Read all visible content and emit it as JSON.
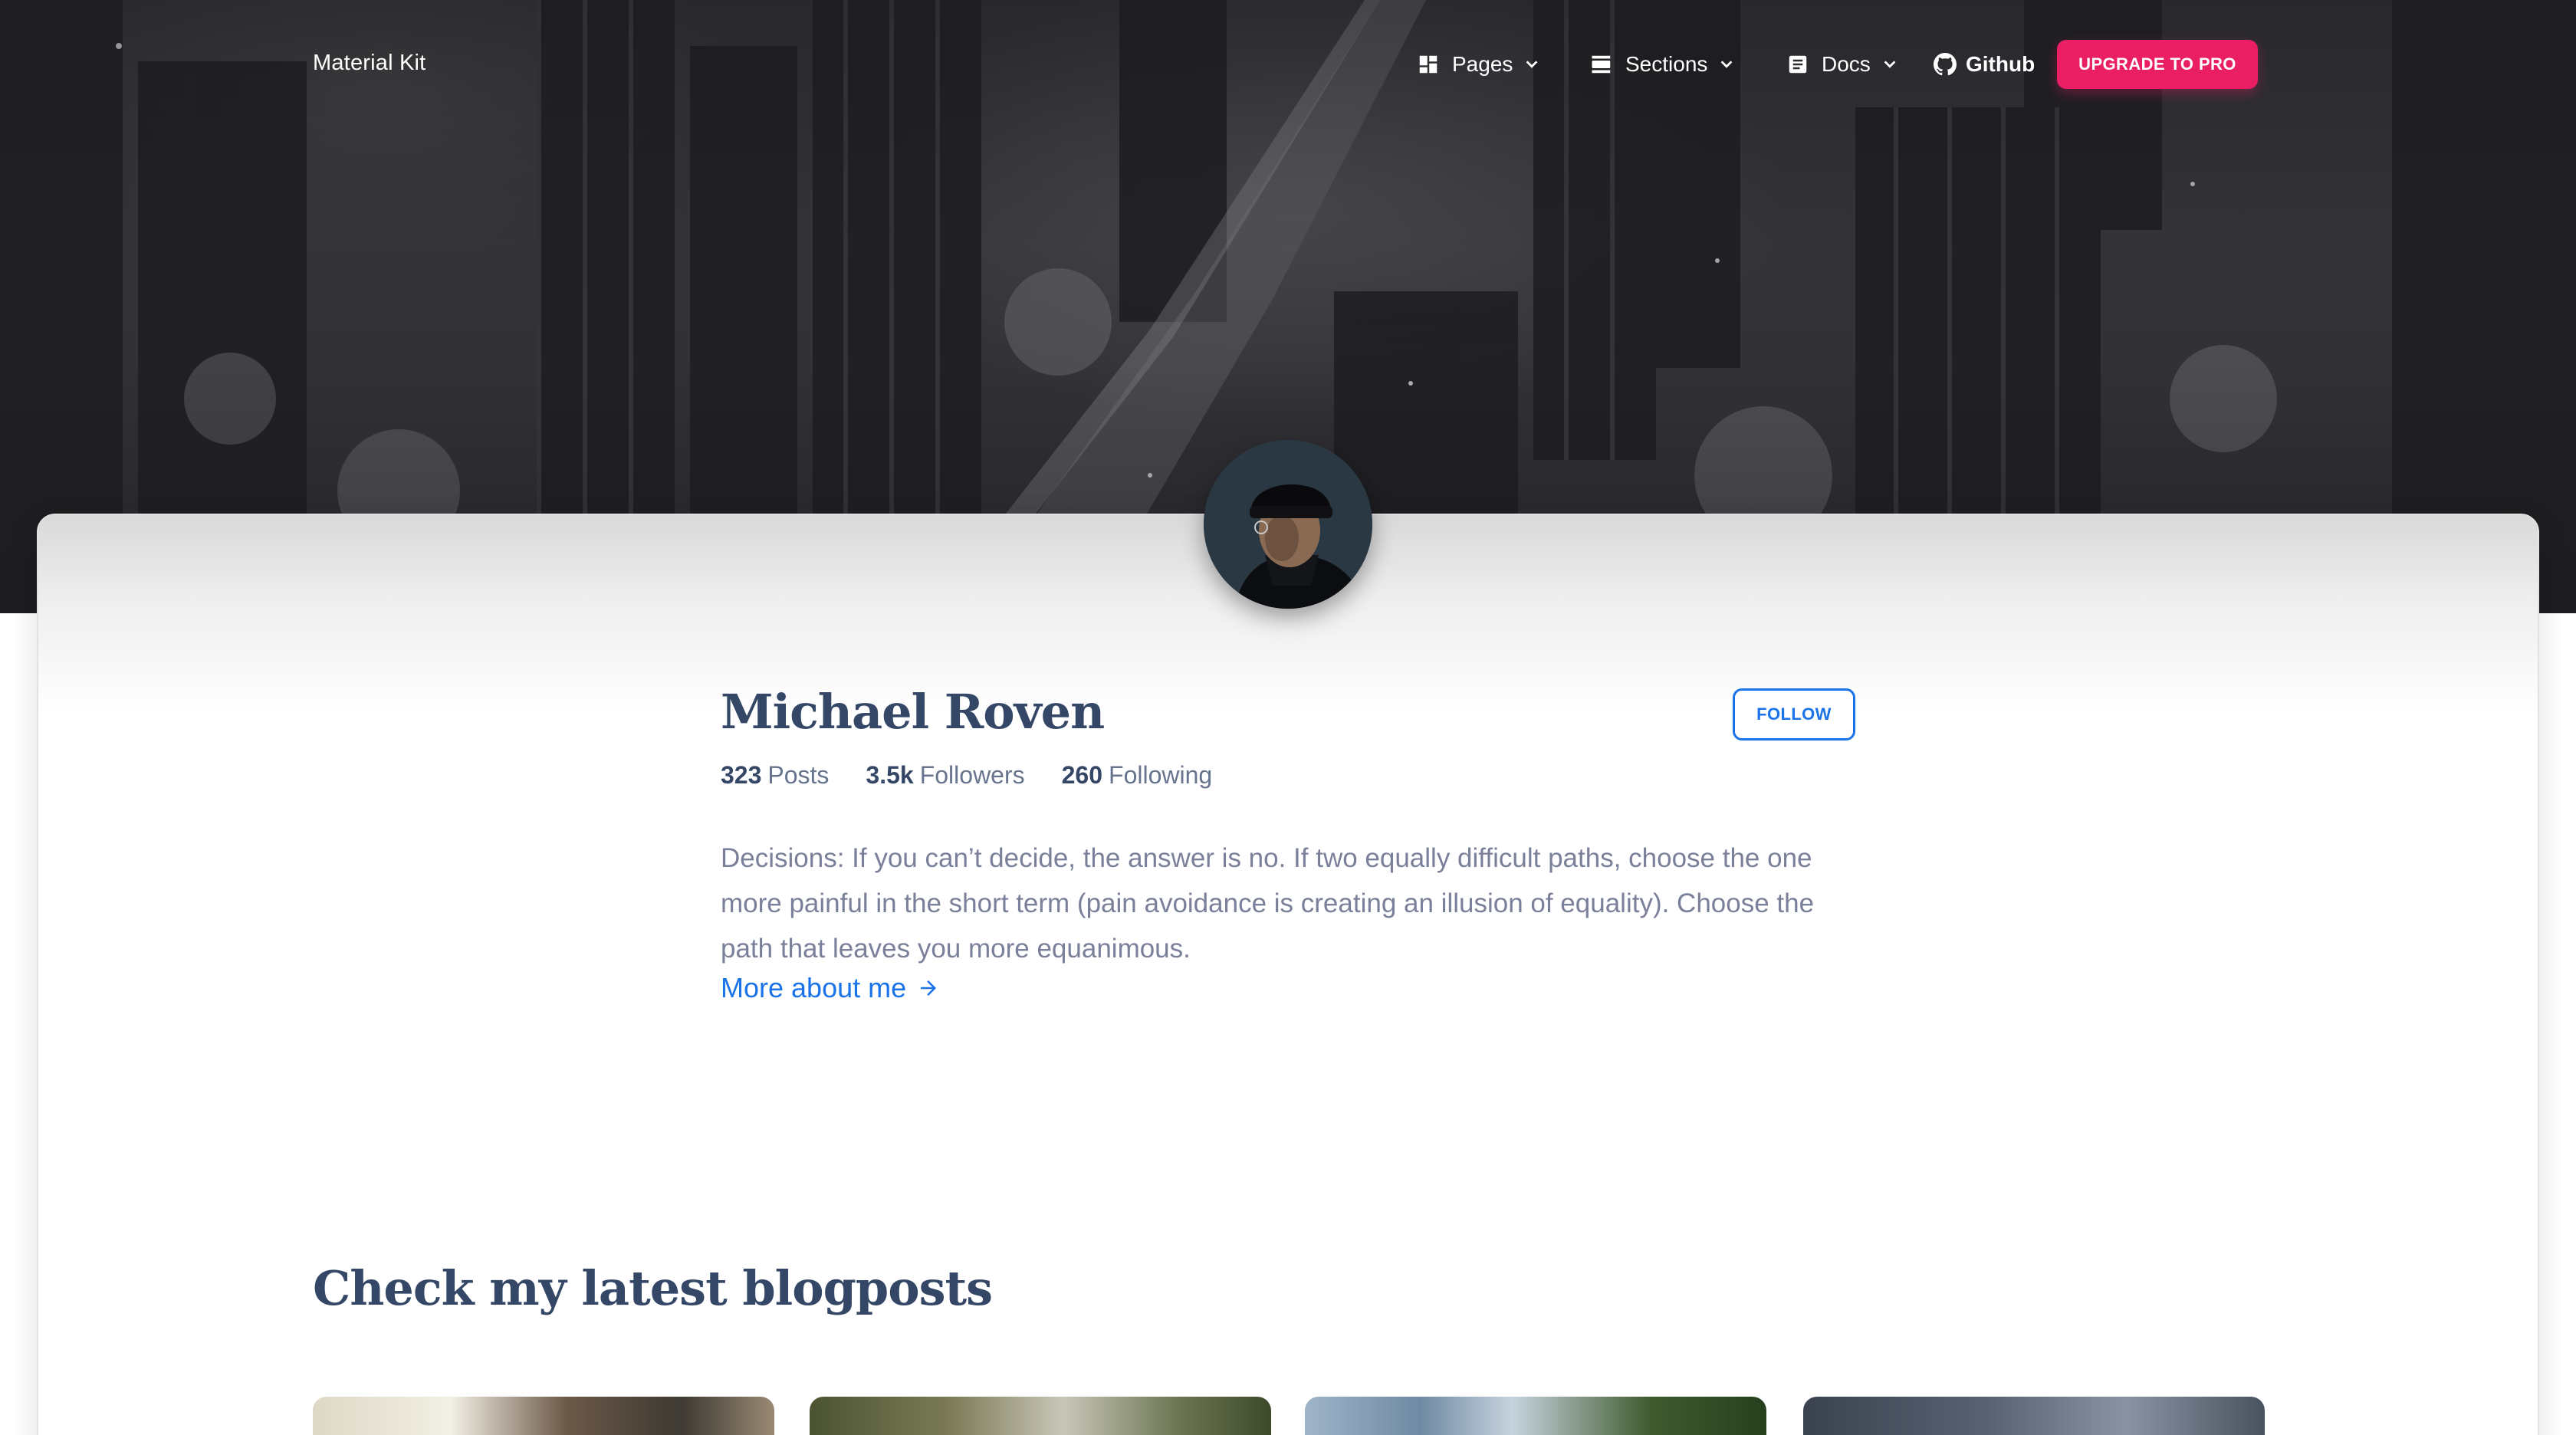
{
  "navbar": {
    "brand": "Material Kit",
    "items": [
      {
        "label": "Pages",
        "icon": "dashboard-icon"
      },
      {
        "label": "Sections",
        "icon": "view-day-icon"
      },
      {
        "label": "Docs",
        "icon": "article-icon"
      }
    ],
    "github_label": "Github",
    "upgrade_label": "UPGRADE TO PRO"
  },
  "profile": {
    "name": "Michael Roven",
    "follow_label": "FOLLOW",
    "stats": [
      {
        "value": "323",
        "label": "Posts"
      },
      {
        "value": "3.5k",
        "label": "Followers"
      },
      {
        "value": "260",
        "label": "Following"
      }
    ],
    "bio": "Decisions: If you can’t decide, the answer is no. If two equally difficult paths, choose the one more painful in the short term (pain avoidance is creating an illusion of equality). Choose the path that leaves you more equanimous.",
    "more_label": "More about me"
  },
  "blog": {
    "title": "Check my latest blogposts"
  },
  "colors": {
    "accent_pink": "#e91e63",
    "link_blue": "#1a73e8",
    "heading": "#344767",
    "text_muted": "#7b809a"
  }
}
